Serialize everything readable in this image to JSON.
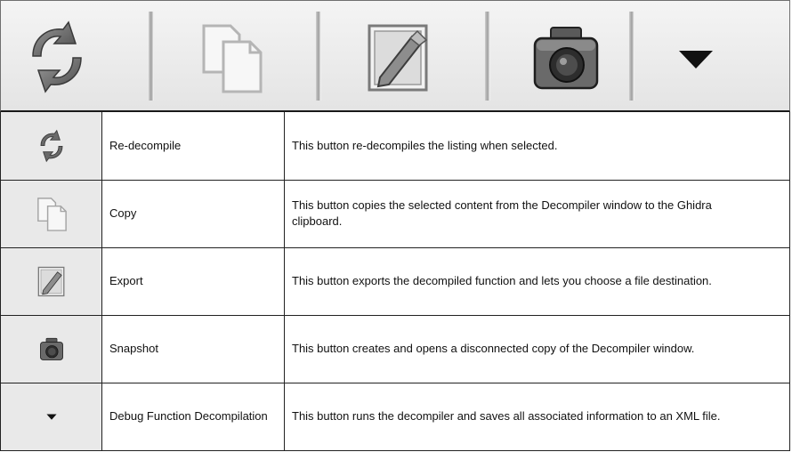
{
  "toolbar": {
    "buttons": [
      {
        "icon": "refresh-icon",
        "label": "Re-decompile"
      },
      {
        "icon": "copy-icon",
        "label": "Copy"
      },
      {
        "icon": "export-icon",
        "label": "Export"
      },
      {
        "icon": "camera-icon",
        "label": "Snapshot"
      },
      {
        "icon": "dropdown-arrow-icon",
        "label": "Debug Function Decompilation"
      }
    ]
  },
  "table": {
    "rows": [
      {
        "icon": "refresh-icon",
        "name": "Re-decompile",
        "description": "This button re-decompiles the listing when selected."
      },
      {
        "icon": "copy-icon",
        "name": "Copy",
        "description": "This button copies the selected content from the Decompiler window to the Ghidra clipboard."
      },
      {
        "icon": "export-icon",
        "name": "Export",
        "description": "This button exports the decompiled function and lets you choose a file destination."
      },
      {
        "icon": "camera-icon",
        "name": "Snapshot",
        "description": "This button creates and opens a disconnected copy of the Decompiler window."
      },
      {
        "icon": "dropdown-arrow-icon",
        "name": "Debug Function Decompilation",
        "description": "This button runs the decompiler and saves all associated information to an XML file."
      }
    ]
  },
  "colors": {
    "toolbar_bg": "#e8e8e8",
    "icon_cell_bg": "#e9e9e9",
    "border": "#222222"
  }
}
